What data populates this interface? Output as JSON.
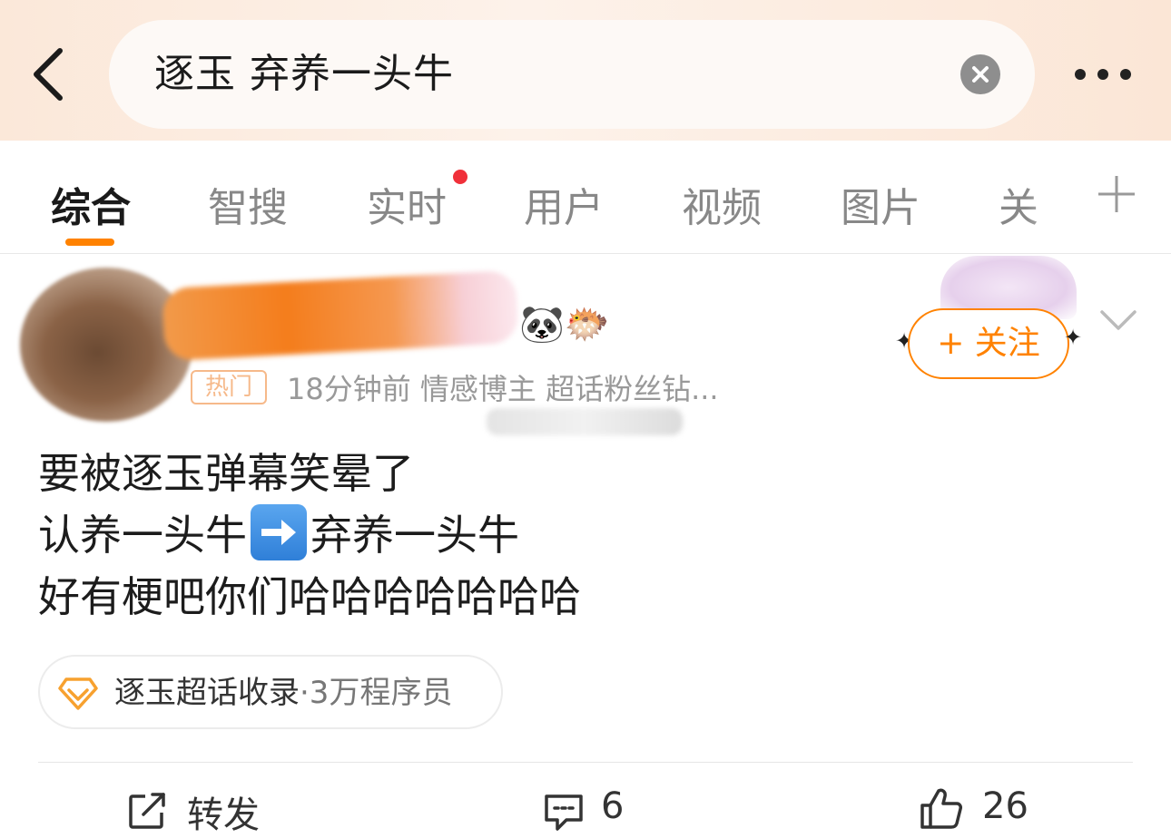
{
  "search": {
    "query": "逐玉 弃养一头牛"
  },
  "tabs": {
    "items": [
      {
        "label": "综合",
        "active": true
      },
      {
        "label": "智搜"
      },
      {
        "label": "实时",
        "badge_dot": true
      },
      {
        "label": "用户"
      },
      {
        "label": "视频"
      },
      {
        "label": "图片"
      },
      {
        "label": "关"
      }
    ]
  },
  "post": {
    "hot_tag": "热门",
    "meta": "18分钟前  情感博主 超话粉丝钻...",
    "follow_label": "+ 关注",
    "badges": "🐼🐡",
    "text": {
      "line1": "要被逐玉弹幕笑晕了",
      "line2_a": "认养一头牛",
      "line2_b": "弃养一头牛",
      "line3": "好有梗吧你们哈哈哈哈哈哈哈"
    },
    "topic": {
      "name": "逐玉超话收录",
      "count": "·3万程序员"
    },
    "actions": {
      "repost_label": "转发",
      "comment_count": "6",
      "like_count": "26"
    }
  },
  "colors": {
    "accent": "#ff8200",
    "header_bg": "#fbe8d9",
    "red_dot": "#f0303a"
  },
  "icons": [
    "back-chevron-icon",
    "clear-icon",
    "more-dots-icon",
    "add-icon",
    "diamond-icon",
    "repost-icon",
    "comment-icon",
    "like-icon",
    "arrow-right-emoji"
  ]
}
